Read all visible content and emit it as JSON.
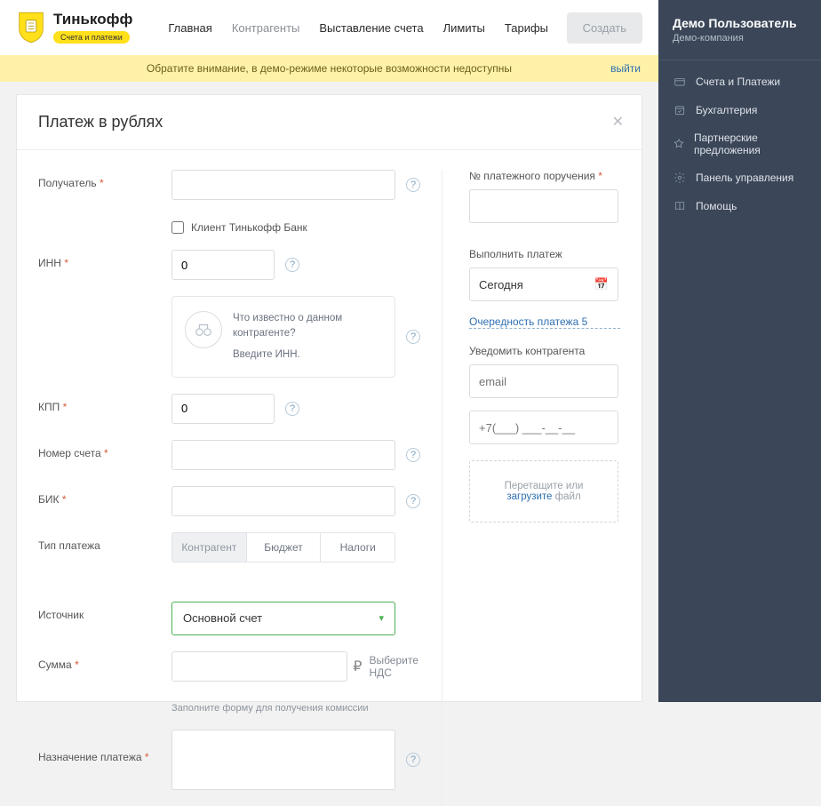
{
  "sidebar": {
    "userName": "Демо Пользователь",
    "userCompany": "Демо-компания",
    "items": [
      {
        "label": "Счета и Платежи"
      },
      {
        "label": "Бухгалтерия"
      },
      {
        "label": "Партнерские предложения"
      },
      {
        "label": "Панель управления"
      },
      {
        "label": "Помощь"
      }
    ]
  },
  "header": {
    "brand": "Тинькофф",
    "brandSub": "Счета и платежи",
    "nav": {
      "main": "Главная",
      "contr": "Контрагенты",
      "bill": "Выставление счета",
      "limits": "Лимиты",
      "tariffs": "Тарифы"
    },
    "createBtn": "Создать"
  },
  "notice": {
    "text": "Обратите внимание, в демо-режиме некоторые возможности недоступны",
    "exit": "выйти"
  },
  "page": {
    "title": "Платеж в рублях"
  },
  "form": {
    "labels": {
      "recipient": "Получатель",
      "clientTinkoff": "Клиент Тинькофф Банк",
      "inn": "ИНН",
      "kpp": "КПП",
      "account": "Номер счета",
      "bik": "БИК",
      "ptype": "Тип платежа",
      "source": "Источник",
      "sum": "Сумма",
      "purpose": "Назначение платежа"
    },
    "values": {
      "inn": "0",
      "kpp": "0",
      "sumCurrency": "₽",
      "vat": "Выберите НДС",
      "sourceSelected": "Основной счет",
      "commissionNote": "Заполните форму для получения комиссии"
    },
    "infoCard": {
      "l1": "Что известно о данном контрагенте?",
      "l2": "Введите ИНН."
    },
    "seg": {
      "a": "Контрагент",
      "b": "Бюджет",
      "c": "Налоги"
    }
  },
  "right": {
    "orderNo": "№ платежного поручения",
    "execute": "Выполнить платеж",
    "date": "Сегодня",
    "priority": "Очередность платежа  5",
    "notify": "Уведомить контрагента",
    "email": "email",
    "phone": "+7(___) ___-__-__",
    "dropA": "Перетащите или",
    "dropB": "загрузите",
    "dropC": " файл"
  }
}
